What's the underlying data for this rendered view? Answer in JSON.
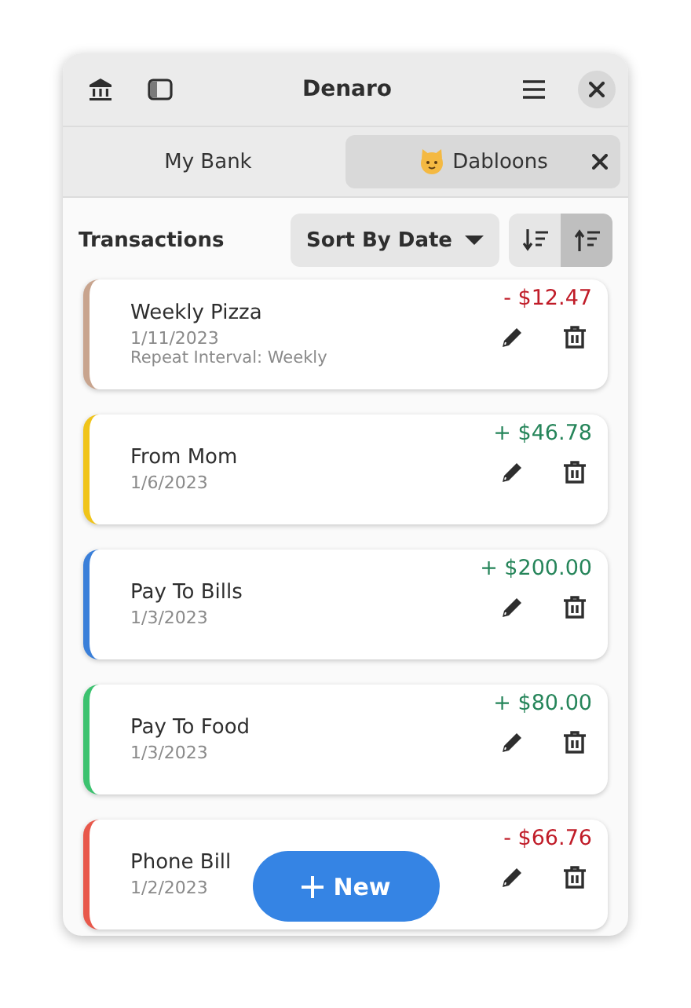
{
  "window": {
    "title": "Denaro"
  },
  "tabs": [
    {
      "label": "My Bank",
      "selected": false,
      "closable": false,
      "emoji": false
    },
    {
      "label": "Dabloons",
      "selected": true,
      "closable": true,
      "emoji": true
    }
  ],
  "section_title": "Transactions",
  "sort_dropdown": {
    "value": "Sort By Date"
  },
  "sort_order": [
    {
      "kind": "descending",
      "selected": false
    },
    {
      "kind": "ascending",
      "selected": true
    }
  ],
  "transactions": [
    {
      "name": "Weekly Pizza",
      "date": "1/11/2023",
      "repeat": "Repeat Interval: Weekly",
      "kind": "expense",
      "sign": "-",
      "amount": "$12.47",
      "color": "#c8a48e"
    },
    {
      "name": "From Mom",
      "date": "1/6/2023",
      "kind": "income",
      "sign": "+",
      "amount": "$46.78",
      "color": "#f0c419"
    },
    {
      "name": "Pay To Bills",
      "date": "1/3/2023",
      "kind": "income",
      "sign": "+",
      "amount": "$200.00",
      "color": "#3a7fd9"
    },
    {
      "name": "Pay To Food",
      "date": "1/3/2023",
      "kind": "income",
      "sign": "+",
      "amount": "$80.00",
      "color": "#3cc26f"
    },
    {
      "name": "Phone Bill",
      "date": "1/2/2023",
      "kind": "expense",
      "sign": "-",
      "amount": "$66.76",
      "color": "#e8584b"
    }
  ],
  "new_button": {
    "label": "New"
  }
}
